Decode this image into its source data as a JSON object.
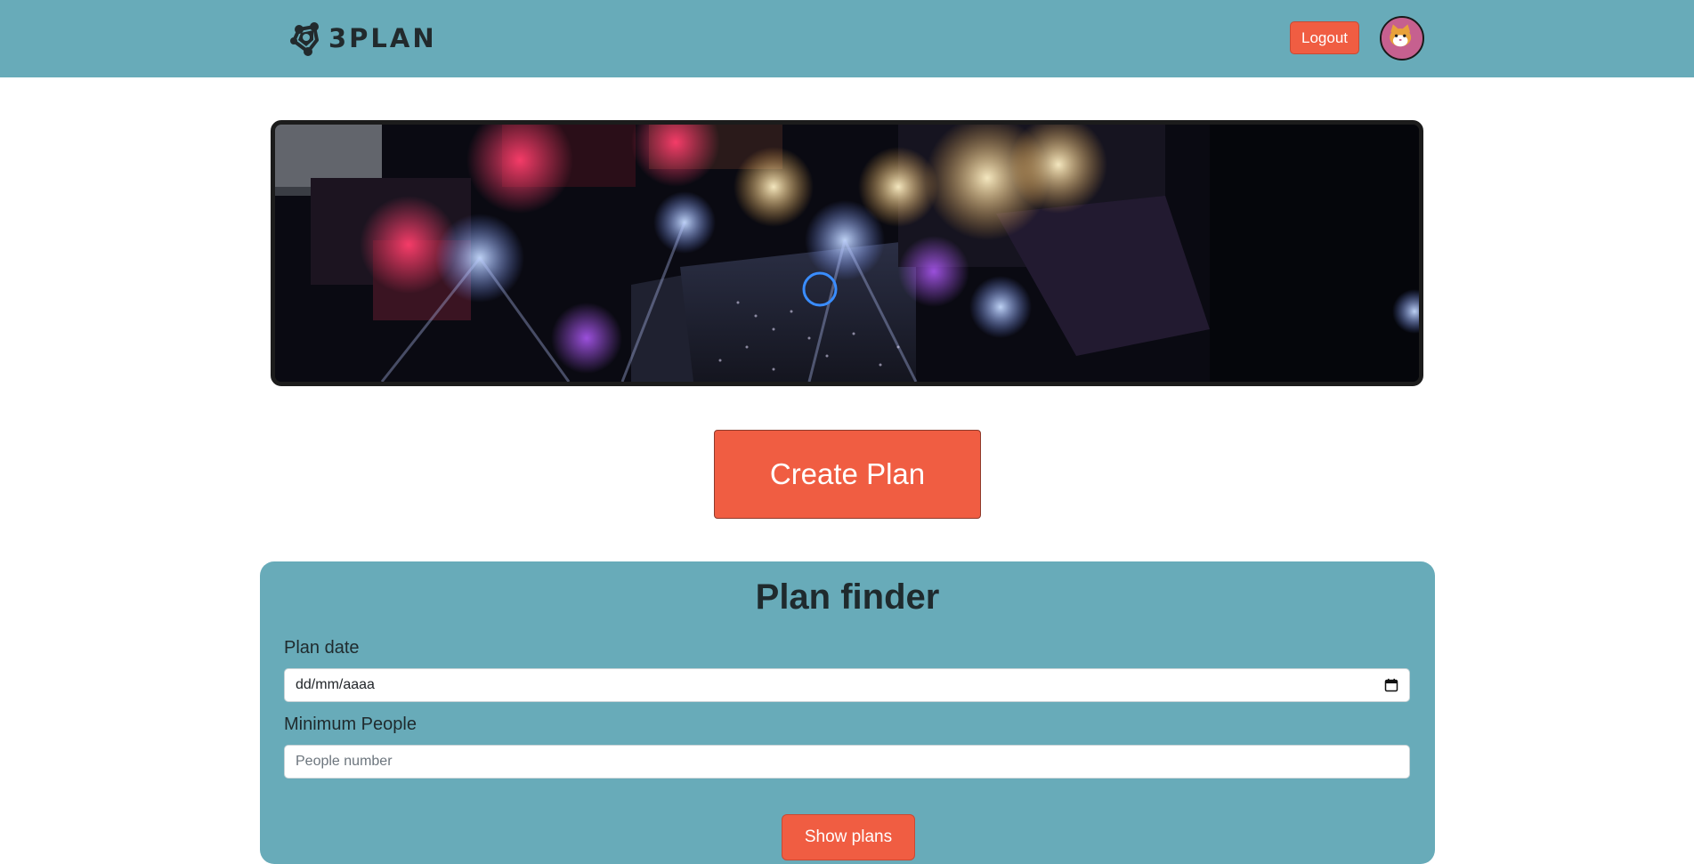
{
  "brand": {
    "name": "3PLAN",
    "logo_icon": "people-network-icon"
  },
  "header": {
    "logout_label": "Logout",
    "avatar_icon": "cat-avatar-icon"
  },
  "banner": {
    "description_icon": "concert-stage-image"
  },
  "actions": {
    "create_plan_label": "Create Plan"
  },
  "finder": {
    "title": "Plan finder",
    "date_label": "Plan date",
    "date_value": "dd/mm/aaaa",
    "people_label": "Minimum People",
    "people_placeholder": "People number",
    "submit_label": "Show plans"
  },
  "colors": {
    "nav": "#68abb9",
    "accent": "#f05d42",
    "text": "#1f2a2d"
  }
}
